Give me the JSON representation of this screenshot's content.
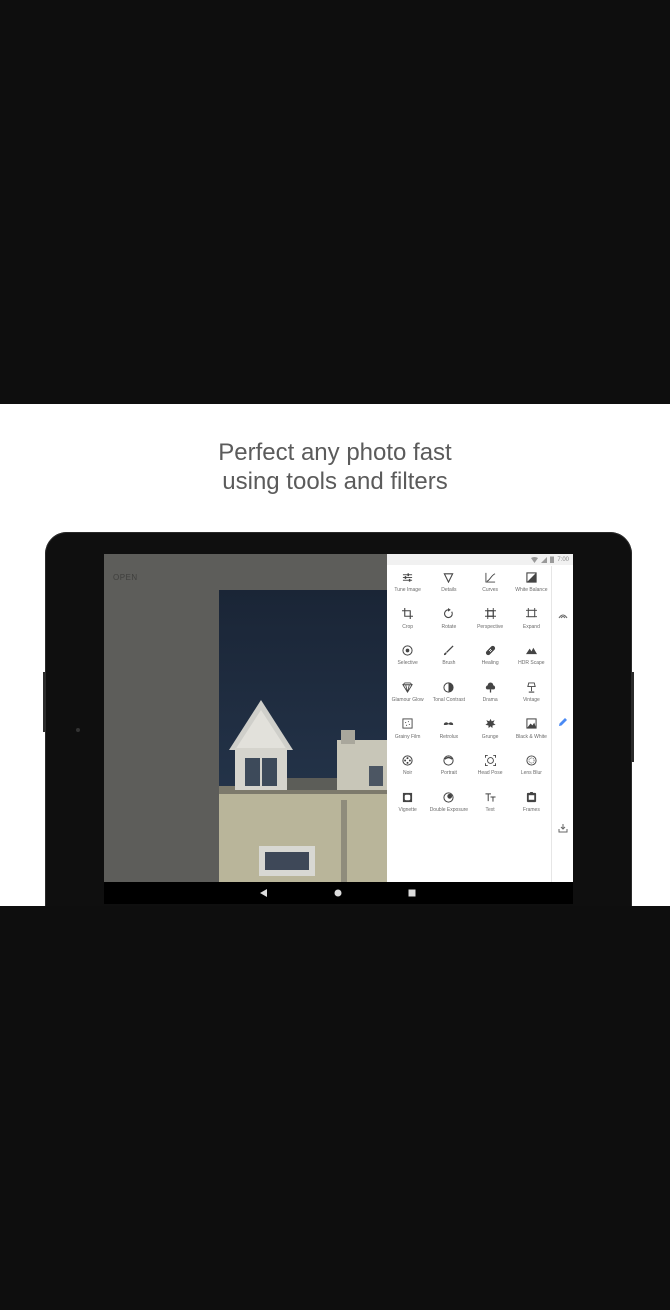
{
  "headline": {
    "line1": "Perfect any photo fast",
    "line2": "using tools and filters"
  },
  "app": {
    "open_label": "OPEN",
    "status_time": "7:00"
  },
  "tools": [
    {
      "label": "Tune Image",
      "icon": "sliders-icon"
    },
    {
      "label": "Details",
      "icon": "triangle-down-icon"
    },
    {
      "label": "Curves",
      "icon": "curve-icon"
    },
    {
      "label": "White Balance",
      "icon": "white-balance-icon"
    },
    {
      "label": "Crop",
      "icon": "crop-icon"
    },
    {
      "label": "Rotate",
      "icon": "rotate-icon"
    },
    {
      "label": "Perspective",
      "icon": "perspective-icon"
    },
    {
      "label": "Expand",
      "icon": "expand-icon"
    },
    {
      "label": "Selective",
      "icon": "target-icon"
    },
    {
      "label": "Brush",
      "icon": "brush-icon"
    },
    {
      "label": "Healing",
      "icon": "bandage-icon"
    },
    {
      "label": "HDR Scape",
      "icon": "mountain-icon"
    },
    {
      "label": "Glamour Glow",
      "icon": "diamond-icon"
    },
    {
      "label": "Tonal Contrast",
      "icon": "contrast-icon"
    },
    {
      "label": "Drama",
      "icon": "cloud-icon"
    },
    {
      "label": "Vintage",
      "icon": "lamp-icon"
    },
    {
      "label": "Grainy Film",
      "icon": "film-icon"
    },
    {
      "label": "Retrolux",
      "icon": "mustache-icon"
    },
    {
      "label": "Grunge",
      "icon": "grunge-icon"
    },
    {
      "label": "Black & White",
      "icon": "bw-icon"
    },
    {
      "label": "Noir",
      "icon": "reel-icon"
    },
    {
      "label": "Portrait",
      "icon": "portrait-icon"
    },
    {
      "label": "Head Pose",
      "icon": "head-pose-icon"
    },
    {
      "label": "Lens Blur",
      "icon": "lens-blur-icon"
    },
    {
      "label": "Vignette",
      "icon": "vignette-icon"
    },
    {
      "label": "Double Exposure",
      "icon": "double-exposure-icon"
    },
    {
      "label": "Text",
      "icon": "text-icon"
    },
    {
      "label": "Frames",
      "icon": "frame-icon"
    }
  ],
  "rail": [
    {
      "icon": "looks-icon"
    },
    {
      "icon": "pencil-icon"
    },
    {
      "icon": "export-icon"
    }
  ],
  "colors": {
    "accent": "#4a8af4",
    "panel_bg": "#ffffff",
    "band_bg": "#0e0e0e"
  }
}
